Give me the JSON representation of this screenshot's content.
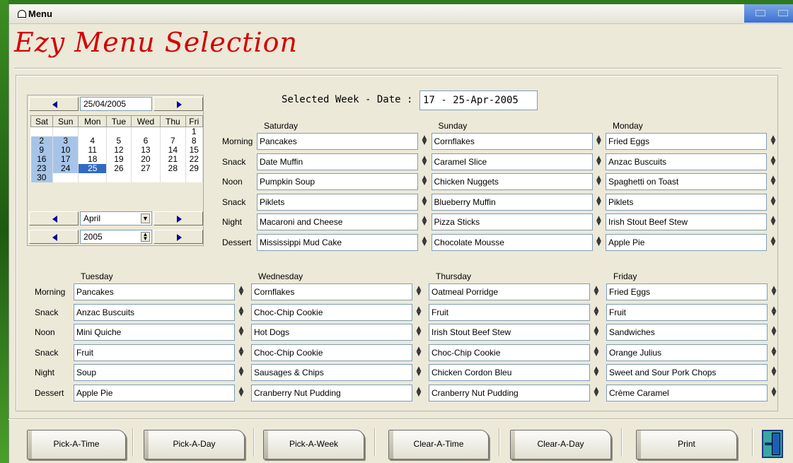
{
  "window": {
    "title": "Menu"
  },
  "app_title": "Ezy Menu Selection",
  "selected_week": {
    "label": "Selected Week - Date :",
    "value": "17 - 25-Apr-2005"
  },
  "calendar": {
    "date": "25/04/2005",
    "day_headers": [
      "Sat",
      "Sun",
      "Mon",
      "Tue",
      "Wed",
      "Thu",
      "Fri"
    ],
    "weeks": [
      [
        "",
        "",
        "",
        "",
        "",
        "",
        "1"
      ],
      [
        "2",
        "3",
        "4",
        "5",
        "6",
        "7",
        "8"
      ],
      [
        "9",
        "10",
        "11",
        "12",
        "13",
        "14",
        "15"
      ],
      [
        "16",
        "17",
        "18",
        "19",
        "20",
        "21",
        "22"
      ],
      [
        "23",
        "24",
        "25",
        "26",
        "27",
        "28",
        "29"
      ],
      [
        "30",
        "",
        "",
        "",
        "",
        "",
        ""
      ]
    ],
    "selected_day": "25",
    "month": "April",
    "year": "2005"
  },
  "meal_labels": [
    "Morning",
    "Snack",
    "Noon",
    "Snack",
    "Night",
    "Dessert"
  ],
  "top_days": [
    {
      "name": "Saturday",
      "meals": [
        "Pancakes",
        "Date Muffin",
        "Pumpkin Soup",
        "Piklets",
        "Macaroni and Cheese",
        "Mississippi Mud Cake"
      ]
    },
    {
      "name": "Sunday",
      "meals": [
        "Cornflakes",
        "Caramel Slice",
        "Chicken Nuggets",
        "Blueberry Muffin",
        "Pizza Sticks",
        "Chocolate Mousse"
      ]
    },
    {
      "name": "Monday",
      "meals": [
        "Fried Eggs",
        "Anzac Buscuits",
        "Spaghetti on Toast",
        "Piklets",
        "Irish Stout Beef Stew",
        "Apple Pie"
      ]
    }
  ],
  "bottom_days": [
    {
      "name": "Tuesday",
      "meals": [
        "Pancakes",
        "Anzac Buscuits",
        "Mini Quiche",
        "Fruit",
        "Soup",
        "Apple Pie"
      ]
    },
    {
      "name": "Wednesday",
      "meals": [
        "Cornflakes",
        "Choc-Chip Cookie",
        "Hot Dogs",
        "Choc-Chip Cookie",
        "Sausages & Chips",
        "Cranberry Nut Pudding"
      ]
    },
    {
      "name": "Thursday",
      "meals": [
        "Oatmeal Porridge",
        "Fruit",
        "Irish Stout Beef Stew",
        "Choc-Chip Cookie",
        "Chicken Cordon Bleu",
        "Cranberry Nut Pudding"
      ]
    },
    {
      "name": "Friday",
      "meals": [
        "Fried Eggs",
        "Fruit",
        "Sandwiches",
        "Orange Julius",
        "Sweet and Sour Pork Chops",
        "Crème Caramel"
      ]
    }
  ],
  "buttons": [
    "Pick-A-Time",
    "Pick-A-Day",
    "Pick-A-Week",
    "Clear-A-Time",
    "Clear-A-Day",
    "Print"
  ],
  "icons": {
    "exit": "exit-door-icon",
    "window": "menu-window-icon"
  }
}
